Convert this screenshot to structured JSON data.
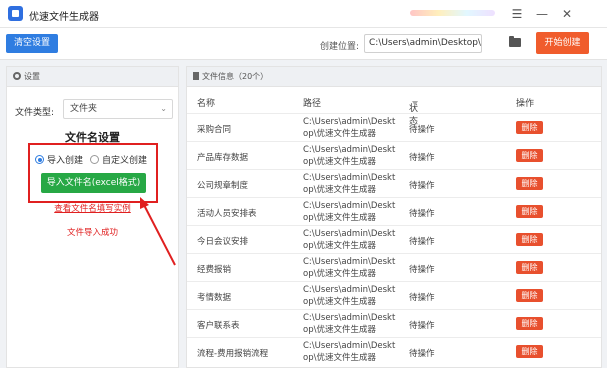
{
  "app": {
    "title": "优速文件生成器"
  },
  "window": {
    "menu_icon": "menu-icon",
    "minimize_icon": "minimize-icon",
    "close_icon": "close-icon"
  },
  "toolbar": {
    "clear_label": "清空设置",
    "path_label": "创建位置:",
    "path_value": "C:\\Users\\admin\\Desktop\\优速",
    "folder_icon": "folder-icon",
    "start_label": "开始创建"
  },
  "left": {
    "header": "设置",
    "type_label": "文件类型:",
    "type_value": "文件夹",
    "section_title": "文件名设置",
    "radio_import": "导入创建",
    "radio_custom": "自定义创建",
    "import_button": "导入文件名(excel格式)",
    "example_link": "查看文件名填写实例",
    "success_text": "文件导入成功"
  },
  "right": {
    "header": "文件信息（20个）",
    "columns": {
      "name": "名称",
      "path": "路径",
      "status": "状态",
      "action": "操作"
    },
    "rows": [
      {
        "name": "采购合同",
        "path1": "C:\\Users\\admin\\Deskt",
        "path2": "op\\优速文件生成器",
        "status": "待操作",
        "action": "删除"
      },
      {
        "name": "产品库存数据",
        "path1": "C:\\Users\\admin\\Deskt",
        "path2": "op\\优速文件生成器",
        "status": "待操作",
        "action": "删除"
      },
      {
        "name": "公司规章制度",
        "path1": "C:\\Users\\admin\\Deskt",
        "path2": "op\\优速文件生成器",
        "status": "待操作",
        "action": "删除"
      },
      {
        "name": "活动人员安排表",
        "path1": "C:\\Users\\admin\\Deskt",
        "path2": "op\\优速文件生成器",
        "status": "待操作",
        "action": "删除"
      },
      {
        "name": "今日会议安排",
        "path1": "C:\\Users\\admin\\Deskt",
        "path2": "op\\优速文件生成器",
        "status": "待操作",
        "action": "删除"
      },
      {
        "name": "经费报销",
        "path1": "C:\\Users\\admin\\Deskt",
        "path2": "op\\优速文件生成器",
        "status": "待操作",
        "action": "删除"
      },
      {
        "name": "考情数据",
        "path1": "C:\\Users\\admin\\Deskt",
        "path2": "op\\优速文件生成器",
        "status": "待操作",
        "action": "删除"
      },
      {
        "name": "客户联系表",
        "path1": "C:\\Users\\admin\\Deskt",
        "path2": "op\\优速文件生成器",
        "status": "待操作",
        "action": "删除"
      },
      {
        "name": "流程-费用报销流程",
        "path1": "C:\\Users\\admin\\Deskt",
        "path2": "op\\优速文件生成器",
        "status": "待操作",
        "action": "删除"
      }
    ]
  }
}
